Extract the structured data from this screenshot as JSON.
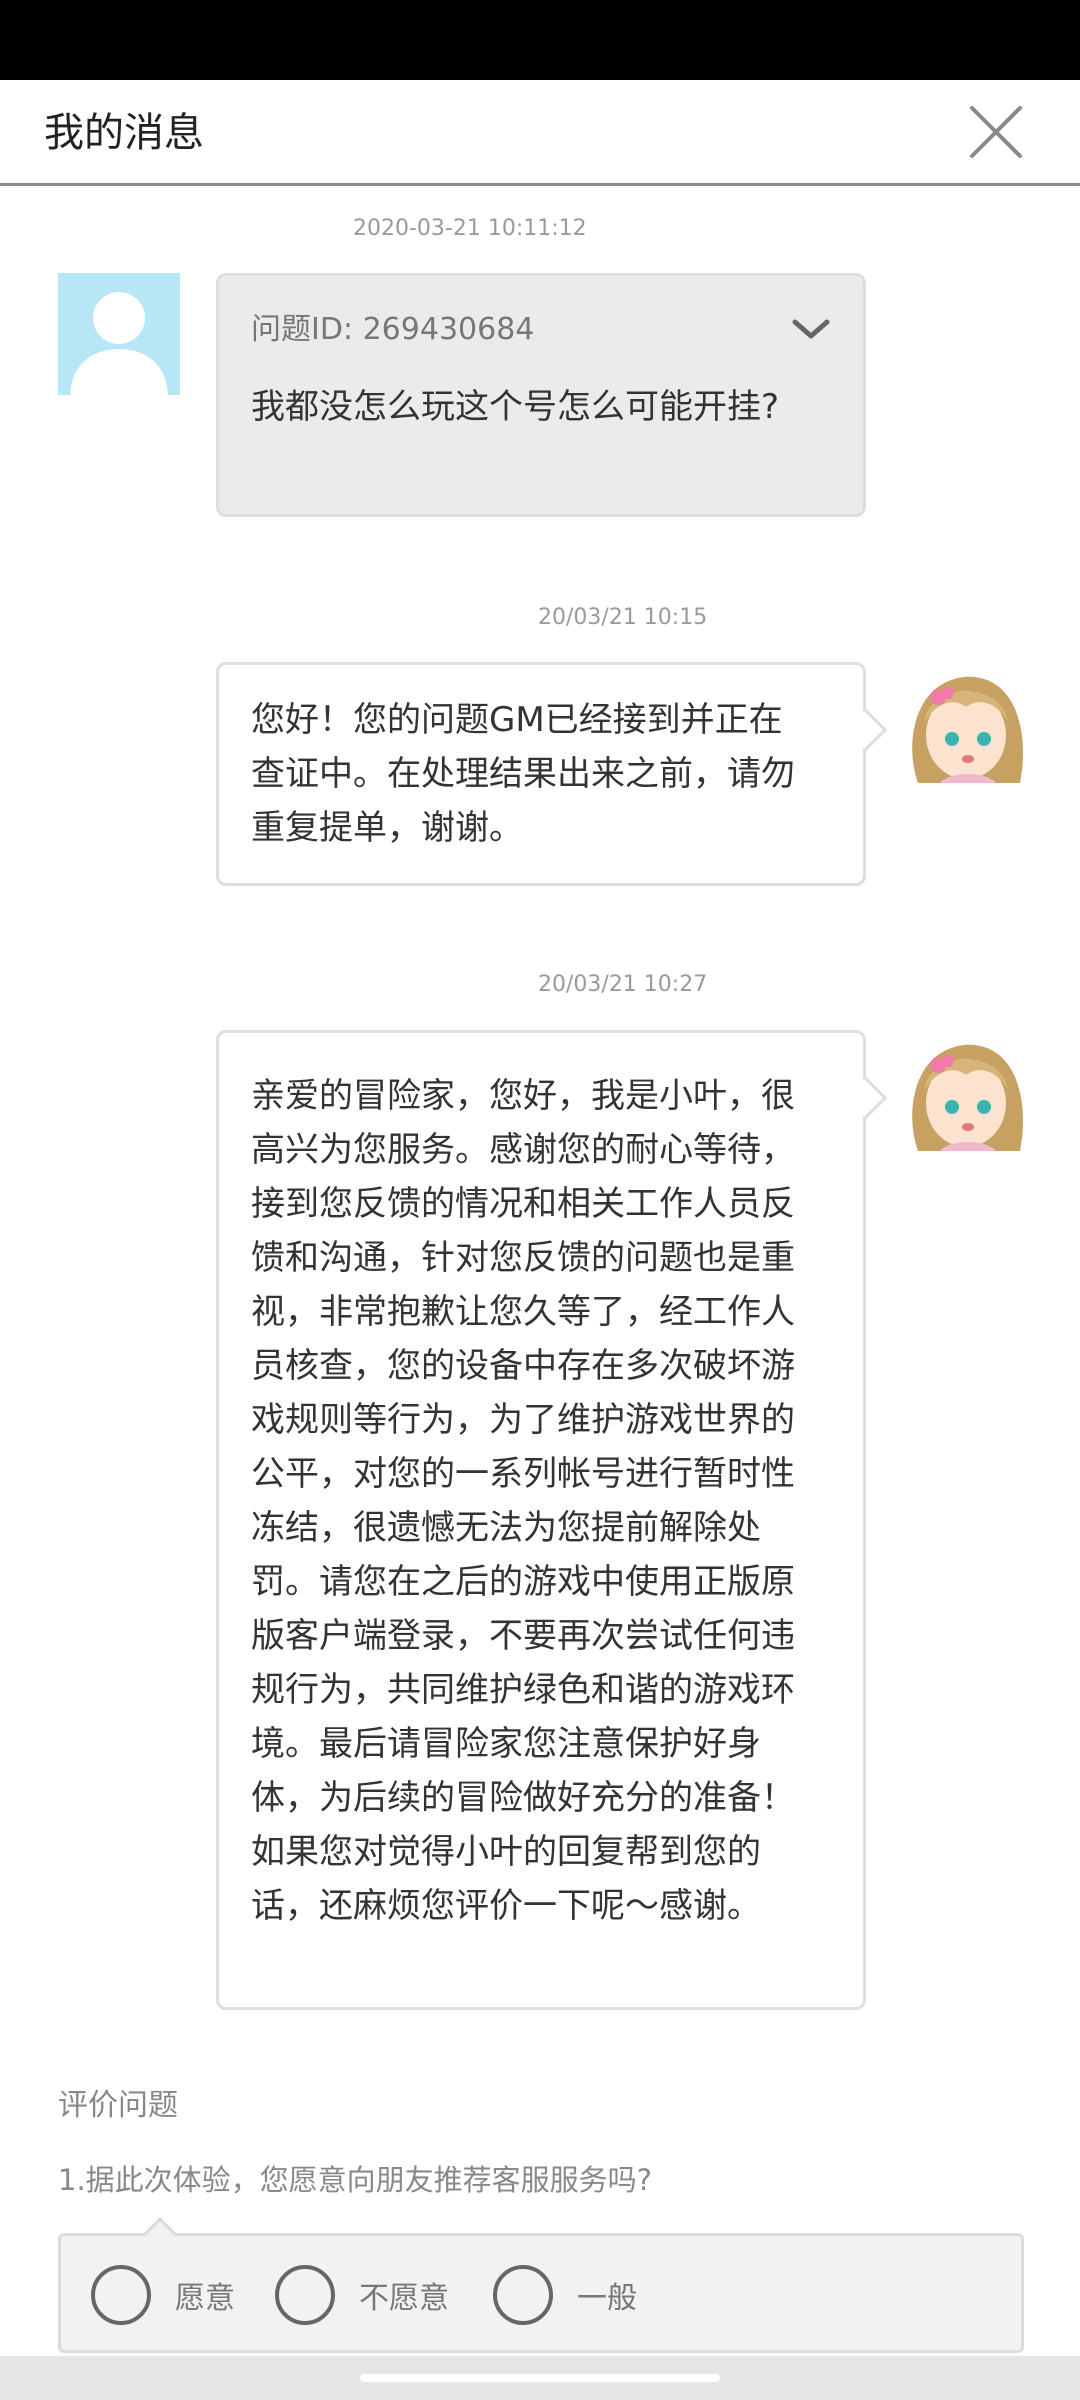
{
  "header": {
    "title": "我的消息"
  },
  "messages": [
    {
      "timestamp": "2020-03-21 10:11:12",
      "question_id": "问题ID: 269430684",
      "text": "我都没怎么玩这个号怎么可能开挂?"
    },
    {
      "timestamp": "20/03/21 10:15",
      "text": "您好！您的问题GM已经接到并正在查证中。在处理结果出来之前，请勿重复提单，谢谢。"
    },
    {
      "timestamp": "20/03/21 10:27",
      "text": "亲爱的冒险家，您好，我是小叶，很高兴为您服务。感谢您的耐心等待，接到您反馈的情况和相关工作人员反馈和沟通，针对您反馈的问题也是重视，非常抱歉让您久等了，经工作人员核查，您的设备中存在多次破坏游戏规则等行为，为了维护游戏世界的公平，对您的一系列帐号进行暂时性冻结，很遗憾无法为您提前解除处罚。请您在之后的游戏中使用正版原版客户端登录，不要再次尝试任何违规行为，共同维护绿色和谐的游戏环境。最后请冒险家您注意保护好身体，为后续的冒险做好充分的准备！如果您对觉得小叶的回复帮到您的话，还麻烦您评价一下呢～感谢。"
    }
  ],
  "rating": {
    "title": "评价问题",
    "question": "1.据此次体验，您愿意向朋友推荐客服服务吗?",
    "options": [
      "愿意",
      "不愿意",
      "一般"
    ]
  },
  "icons": {
    "close": "close-icon",
    "expand": "chevron-down-icon",
    "user_avatar": "default-user-icon",
    "gm_avatar": "gm-girl-avatar"
  },
  "colors": {
    "user_avatar_bg": "#b7e6f6",
    "user_bubble_bg": "#ebebeb",
    "gm_bubble_bg": "#ffffff",
    "timestamp_text": "#9a9a9a"
  }
}
